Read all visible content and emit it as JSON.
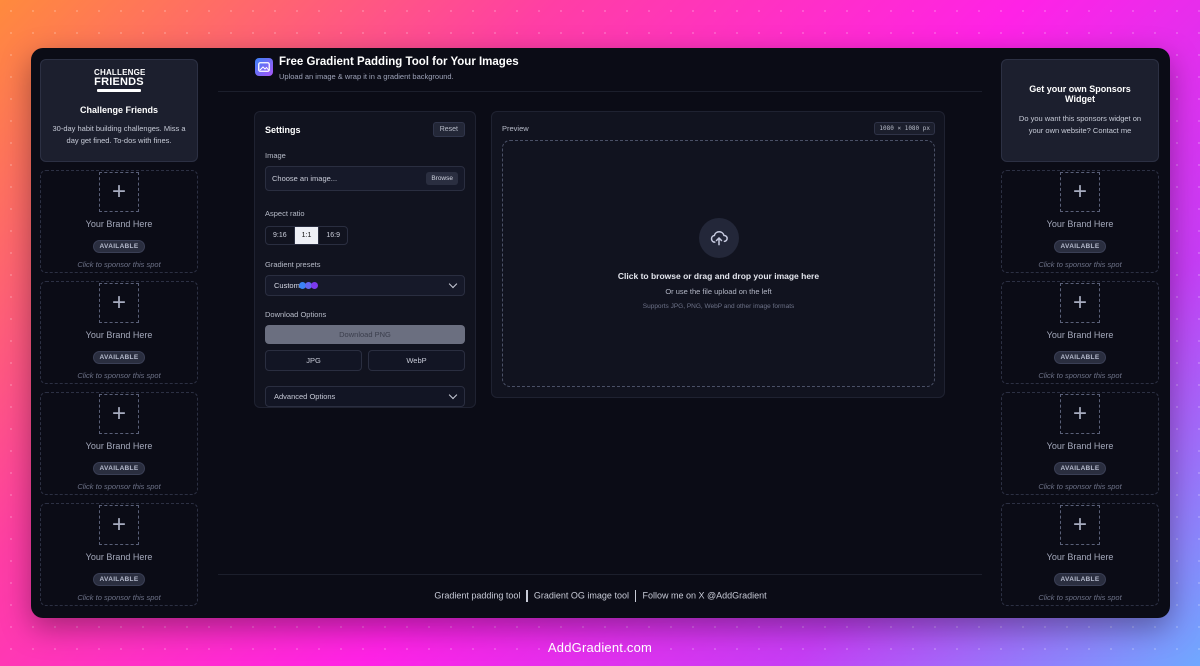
{
  "header": {
    "title": "Free Gradient Padding Tool for Your Images",
    "subtitle": "Upload an image & wrap it in a gradient background."
  },
  "left_sidebar": {
    "featured": {
      "logo_line1": "CHALLENGE",
      "logo_line2": "FRIENDS",
      "name": "Challenge Friends",
      "description": "30-day habit building challenges. Miss a day get fined. To-dos with fines."
    },
    "slots": [
      {
        "brand": "Your Brand Here",
        "badge": "AVAILABLE",
        "cta": "Click to sponsor this spot"
      },
      {
        "brand": "Your Brand Here",
        "badge": "AVAILABLE",
        "cta": "Click to sponsor this spot"
      },
      {
        "brand": "Your Brand Here",
        "badge": "AVAILABLE",
        "cta": "Click to sponsor this spot"
      },
      {
        "brand": "Your Brand Here",
        "badge": "AVAILABLE",
        "cta": "Click to sponsor this spot"
      }
    ]
  },
  "right_sidebar": {
    "featured": {
      "name": "Get your own Sponsors Widget",
      "description": "Do you want this sponsors widget on your own website? Contact me"
    },
    "slots": [
      {
        "brand": "Your Brand Here",
        "badge": "AVAILABLE",
        "cta": "Click to sponsor this spot"
      },
      {
        "brand": "Your Brand Here",
        "badge": "AVAILABLE",
        "cta": "Click to sponsor this spot"
      },
      {
        "brand": "Your Brand Here",
        "badge": "AVAILABLE",
        "cta": "Click to sponsor this spot"
      },
      {
        "brand": "Your Brand Here",
        "badge": "AVAILABLE",
        "cta": "Click to sponsor this spot"
      }
    ]
  },
  "settings": {
    "title": "Settings",
    "reset_label": "Reset",
    "image_label": "Image",
    "file_placeholder": "Choose an image...",
    "browse_label": "Browse",
    "aspect_label": "Aspect ratio",
    "aspect_options": [
      "9:16",
      "1:1",
      "16:9"
    ],
    "aspect_selected": "1:1",
    "presets_label": "Gradient presets",
    "preset_selected": "Custom",
    "preset_swatches": [
      "#3b82f6",
      "#6366f1",
      "#7c3aed"
    ],
    "download_label": "Download Options",
    "download_png": "Download PNG",
    "download_jpg": "JPG",
    "download_webp": "WebP",
    "advanced_label": "Advanced Options"
  },
  "preview": {
    "label": "Preview",
    "dimensions": "1080 × 1080 px",
    "drop_main": "Click to browse or drag and drop your image here",
    "drop_sub": "Or use the file upload on the left",
    "drop_formats": "Supports JPG, PNG, WebP and other image formats"
  },
  "footer": {
    "links": [
      "Gradient padding tool",
      "Gradient OG image tool",
      "Follow me on X @AddGradient"
    ]
  },
  "watermark": "AddGradient.com"
}
